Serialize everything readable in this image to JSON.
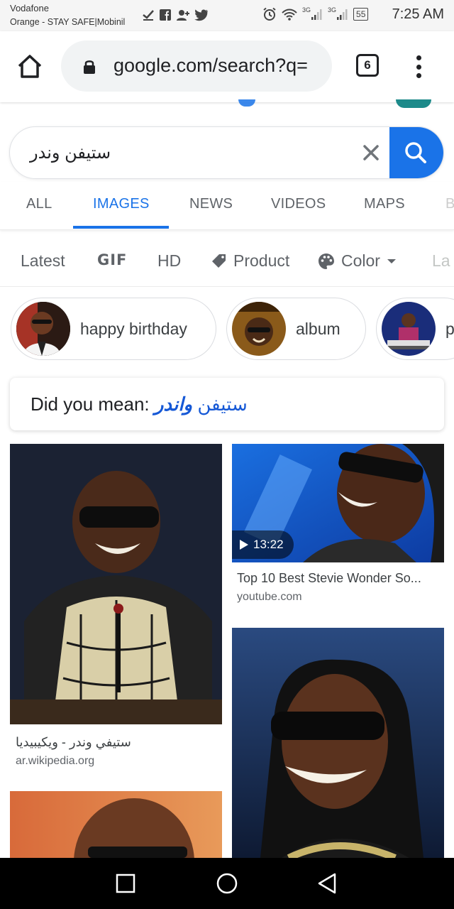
{
  "status_bar": {
    "carrier_line1": "Vodafone",
    "carrier_line2": "Orange - STAY SAFE|Mobinil",
    "network_1": "3G",
    "network_2": "3G",
    "battery": "55",
    "time": "7:25 AM",
    "icons": [
      "check-icon",
      "facebook-icon",
      "person-add-icon",
      "twitter-icon",
      "alarm-icon",
      "wifi-icon",
      "signal-icon",
      "signal-icon",
      "battery-icon"
    ]
  },
  "browser": {
    "url": "google.com/search?q=",
    "tab_count": "6"
  },
  "search": {
    "query": "ستيفن وندر"
  },
  "tabs": [
    {
      "label": "ALL",
      "active": false
    },
    {
      "label": "IMAGES",
      "active": true
    },
    {
      "label": "NEWS",
      "active": false
    },
    {
      "label": "VIDEOS",
      "active": false
    },
    {
      "label": "MAPS",
      "active": false
    },
    {
      "label": "B",
      "active": false
    }
  ],
  "filters": [
    {
      "label": "Latest"
    },
    {
      "label": "GIF"
    },
    {
      "label": "HD"
    },
    {
      "label": "Product"
    },
    {
      "label": "Color"
    },
    {
      "label": "La"
    }
  ],
  "related": [
    {
      "label": "happy birthday"
    },
    {
      "label": "album"
    },
    {
      "label": "p"
    }
  ],
  "did_you_mean": {
    "prefix": "Did you mean: ",
    "bold_part": "واندر",
    "plain_part": "ستيفن"
  },
  "results": [
    {
      "title": "ستيفي وندر - ويكيبيديا",
      "source": "ar.wikipedia.org"
    },
    {
      "title": "Top 10 Best Stevie Wonder So...",
      "source": "youtube.com",
      "duration": "13:22"
    },
    {
      "title": "",
      "source": ""
    },
    {
      "title": "",
      "source": ""
    }
  ],
  "colors": {
    "accent": "#1a73e8",
    "link": "#1558d6"
  }
}
